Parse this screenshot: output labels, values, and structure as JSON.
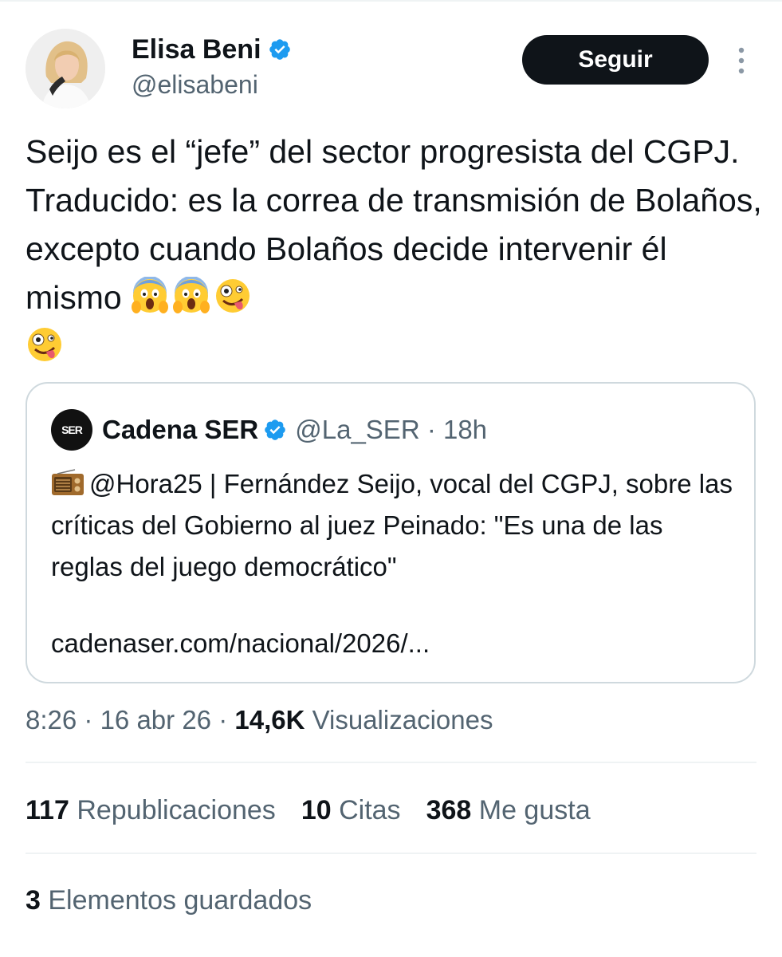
{
  "author": {
    "name": "Elisa Beni",
    "handle": "@elisabeni",
    "verified": true
  },
  "follow_button": {
    "label": "Seguir"
  },
  "tweet": {
    "text": "Seijo es el “jefe” del sector progresista del CGPJ. Traducido: es la correa de transmisión de Bolaños, excepto cuando Bolaños decide intervenir él mismo",
    "emojis": [
      "screaming-face",
      "screaming-face",
      "zany-face",
      "zany-face"
    ]
  },
  "quote": {
    "name": "Cadena SER",
    "logo_text": "SER",
    "handle_time": "@La_SER · 18h",
    "text": "@Hora25 | Fernández Seijo, vocal del CGPJ, sobre las críticas del Gobierno al juez Peinado: \"Es una de las reglas del juego democrático\"",
    "link": "cadenaser.com/nacional/2026/..."
  },
  "meta": {
    "time": "8:26",
    "date": "16 abr 26",
    "views_count": "14,6K",
    "views_label": "Visualizaciones"
  },
  "stats": {
    "reposts_count": "117",
    "reposts_label": "Republicaciones",
    "quotes_count": "10",
    "quotes_label": "Citas",
    "likes_count": "368",
    "likes_label": "Me gusta"
  },
  "saved": {
    "count": "3",
    "label": "Elementos guardados"
  },
  "colors": {
    "text": "#0f1419",
    "secondary": "#536471",
    "verified_blue": "#1d9bf0",
    "border": "#cfd9de"
  }
}
